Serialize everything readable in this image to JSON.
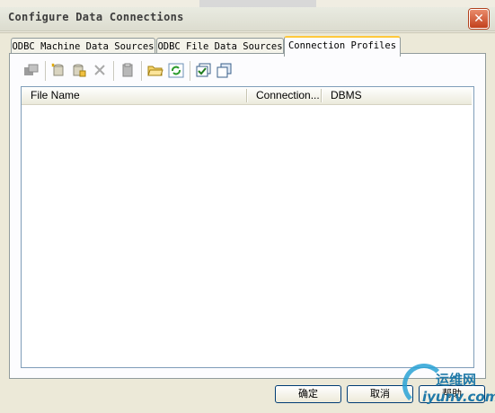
{
  "window": {
    "title": "Configure Data Connections",
    "close_symbol": "✕"
  },
  "tabs": [
    {
      "label": "ODBC Machine Data Sources",
      "active": false
    },
    {
      "label": "ODBC File Data Sources",
      "active": false
    },
    {
      "label": "Connection Profiles",
      "active": true
    }
  ],
  "toolbar": {
    "icons": [
      "connect-icon",
      "new-profile-icon",
      "edit-profile-icon",
      "delete-icon",
      "clipboard-icon",
      "open-folder-icon",
      "refresh-icon",
      "check-icon",
      "copy-icon"
    ]
  },
  "list": {
    "columns": [
      "File Name",
      "Connection...",
      "DBMS"
    ],
    "rows": []
  },
  "buttons": {
    "ok": "确定",
    "cancel": "取消",
    "help": "帮助"
  },
  "watermark": {
    "cn": "运维网",
    "en": "iyunv.com"
  }
}
